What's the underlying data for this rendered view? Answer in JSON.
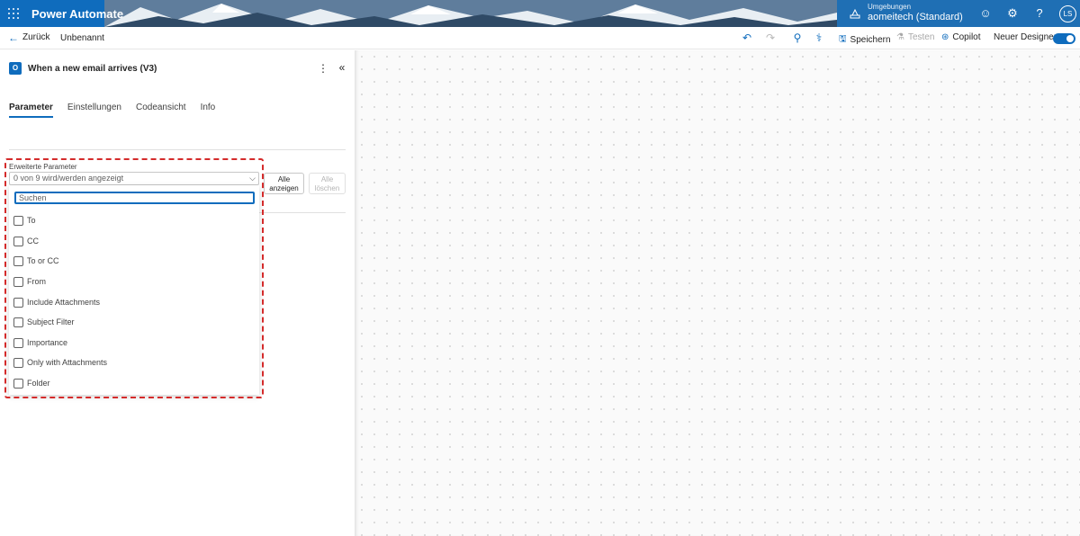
{
  "header": {
    "brand": "Power Automate",
    "environment_label": "Umgebungen",
    "environment_name": "aomeitech (Standard)",
    "avatar_initials": "LS"
  },
  "commandbar": {
    "back_label": "Zurück",
    "flow_name": "Unbenannt",
    "save_label": "Speichern",
    "test_label": "Testen",
    "copilot_label": "Copilot",
    "new_designer_label": "Neuer Designer",
    "new_designer_enabled": true
  },
  "panel": {
    "trigger_title": "When a new email arrives (V3)",
    "tabs": [
      {
        "label": "Parameter",
        "active": true
      },
      {
        "label": "Einstellungen",
        "active": false
      },
      {
        "label": "Codeansicht",
        "active": false
      },
      {
        "label": "Info",
        "active": false
      }
    ],
    "advanced": {
      "label": "Erweiterte Parameter",
      "dropdown_value": "0 von 9 wird/werden angezeigt",
      "show_all_label": [
        "Alle",
        "anzeigen"
      ],
      "clear_all_label": [
        "Alle",
        "löschen"
      ],
      "search_placeholder": "Suchen",
      "options": [
        "To",
        "CC",
        "To or CC",
        "From",
        "Include Attachments",
        "Subject Filter",
        "Importance",
        "Only with Attachments",
        "Folder"
      ]
    }
  },
  "colors": {
    "accent": "#0f6cbd",
    "highlight": "#d42b2b"
  }
}
